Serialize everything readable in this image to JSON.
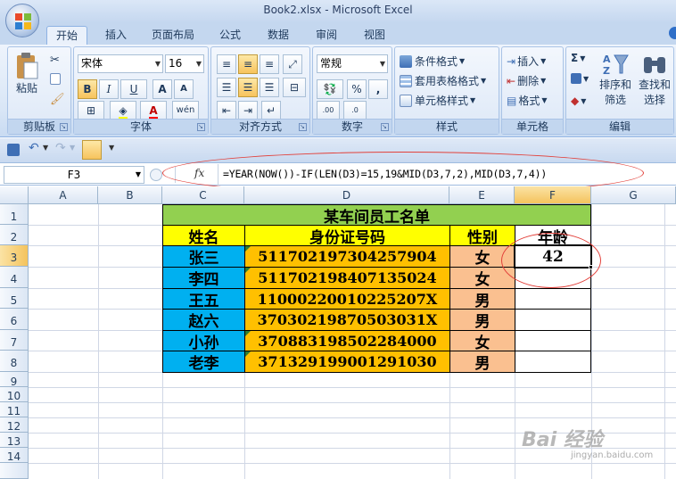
{
  "window": {
    "title": "Book2.xlsx - Microsoft Excel"
  },
  "tabs": [
    "开始",
    "插入",
    "页面布局",
    "公式",
    "数据",
    "审阅",
    "视图"
  ],
  "ribbon": {
    "clipboard": {
      "label": "剪贴板",
      "paste": "粘贴"
    },
    "font": {
      "label": "字体",
      "name": "宋体",
      "size": "16",
      "bold": "B",
      "italic": "I",
      "underline": "U",
      "grow": "A",
      "shrink": "A",
      "font_color_letter": "A",
      "phonetic": "wén"
    },
    "alignment": {
      "label": "对齐方式"
    },
    "number": {
      "label": "数字",
      "format": "常规",
      "percent": "%",
      "comma": ",",
      "inc": ".00",
      "dec": ".0"
    },
    "styles": {
      "label": "样式",
      "conditional": "条件格式",
      "table": "套用表格格式",
      "cell_styles": "单元格样式"
    },
    "cells": {
      "label": "单元格",
      "insert": "插入",
      "delete": "删除",
      "format": "格式"
    },
    "editing": {
      "label": "编辑",
      "sort": "排序和",
      "filter": "筛选",
      "find": "查找和",
      "select": "选择",
      "sigma": "Σ"
    }
  },
  "formula_bar": {
    "name_box": "F3",
    "fx": "fx",
    "formula": "=YEAR(NOW())-IF(LEN(D3)=15,19&MID(D3,7,2),MID(D3,7,4))"
  },
  "columns": [
    "A",
    "B",
    "C",
    "D",
    "E",
    "F",
    "G"
  ],
  "rows": [
    "1",
    "2",
    "3",
    "4",
    "5",
    "6",
    "7",
    "8",
    "9",
    "10",
    "11",
    "12",
    "13",
    "14"
  ],
  "sheet": {
    "title": "某车间员工名单",
    "headers": [
      "姓名",
      "身份证号码",
      "性别",
      "年龄"
    ],
    "records": [
      {
        "name": "张三",
        "id": "511702197304257904",
        "gender": "女",
        "age": "42"
      },
      {
        "name": "李四",
        "id": "511702198407135024",
        "gender": "女",
        "age": ""
      },
      {
        "name": "王五",
        "id": "11000220010225207X",
        "gender": "男",
        "age": ""
      },
      {
        "name": "赵六",
        "id": "37030219870503031X",
        "gender": "男",
        "age": ""
      },
      {
        "name": "小孙",
        "id": "370883198502284000",
        "gender": "女",
        "age": ""
      },
      {
        "name": "老李",
        "id": "371329199001291030",
        "gender": "男",
        "age": ""
      }
    ]
  },
  "colors": {
    "title_fill": "#92d050",
    "header_fill": "#ffff00",
    "name_fill": "#00b0f0",
    "id_fill": "#ffc000",
    "gender_fill": "#fac090",
    "annotation": "#e2403a"
  },
  "watermark": {
    "brand": "Bai 经验",
    "url": "jingyan.baidu.com"
  }
}
